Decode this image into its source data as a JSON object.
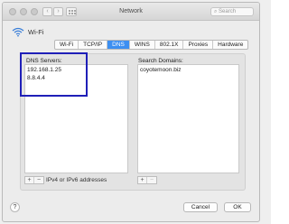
{
  "window": {
    "title": "Network",
    "search_placeholder": "Search"
  },
  "interface": {
    "name": "Wi-Fi"
  },
  "tabs": [
    {
      "label": "Wi-Fi"
    },
    {
      "label": "TCP/IP"
    },
    {
      "label": "DNS",
      "active": true
    },
    {
      "label": "WINS"
    },
    {
      "label": "802.1X"
    },
    {
      "label": "Proxies"
    },
    {
      "label": "Hardware"
    }
  ],
  "dns": {
    "servers_label": "DNS Servers:",
    "servers": [
      "192.168.1.25",
      "8.8.4.4"
    ],
    "domains_label": "Search Domains:",
    "domains": [
      "coyotemoon.biz"
    ],
    "hint": "IPv4 or IPv6 addresses"
  },
  "controls": {
    "add_symbol": "+",
    "remove_symbol": "−"
  },
  "footer": {
    "help": "?",
    "cancel": "Cancel",
    "ok": "OK"
  },
  "colors": {
    "accent": "#3d8ff1",
    "highlight_box": "#1f1fb8"
  }
}
